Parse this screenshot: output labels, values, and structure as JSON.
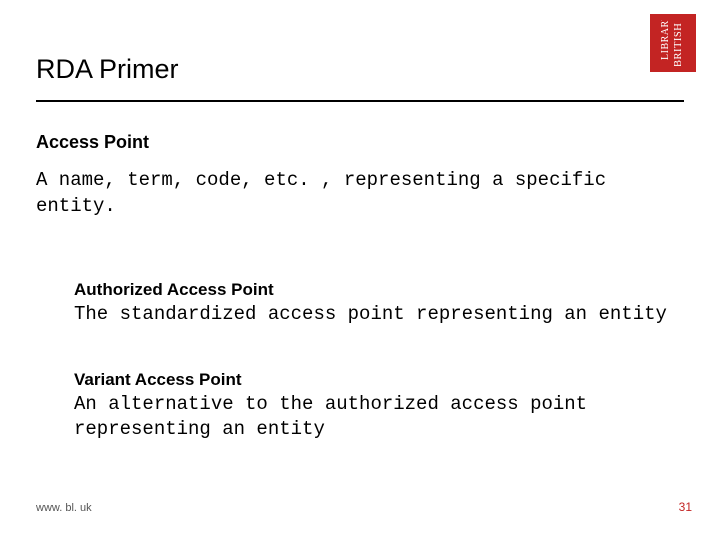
{
  "title": "RDA Primer",
  "section_heading": "Access Point",
  "body": "A name, term, code, etc. , representing a specific entity.",
  "sub": [
    {
      "heading": "Authorized Access Point",
      "body": "The standardized access point representing an entity"
    },
    {
      "heading": "Variant Access Point",
      "body": "An alternative to the authorized access point representing an entity"
    }
  ],
  "footer_url": "www. bl. uk",
  "page_number": "31",
  "logo_alt": "British Library"
}
